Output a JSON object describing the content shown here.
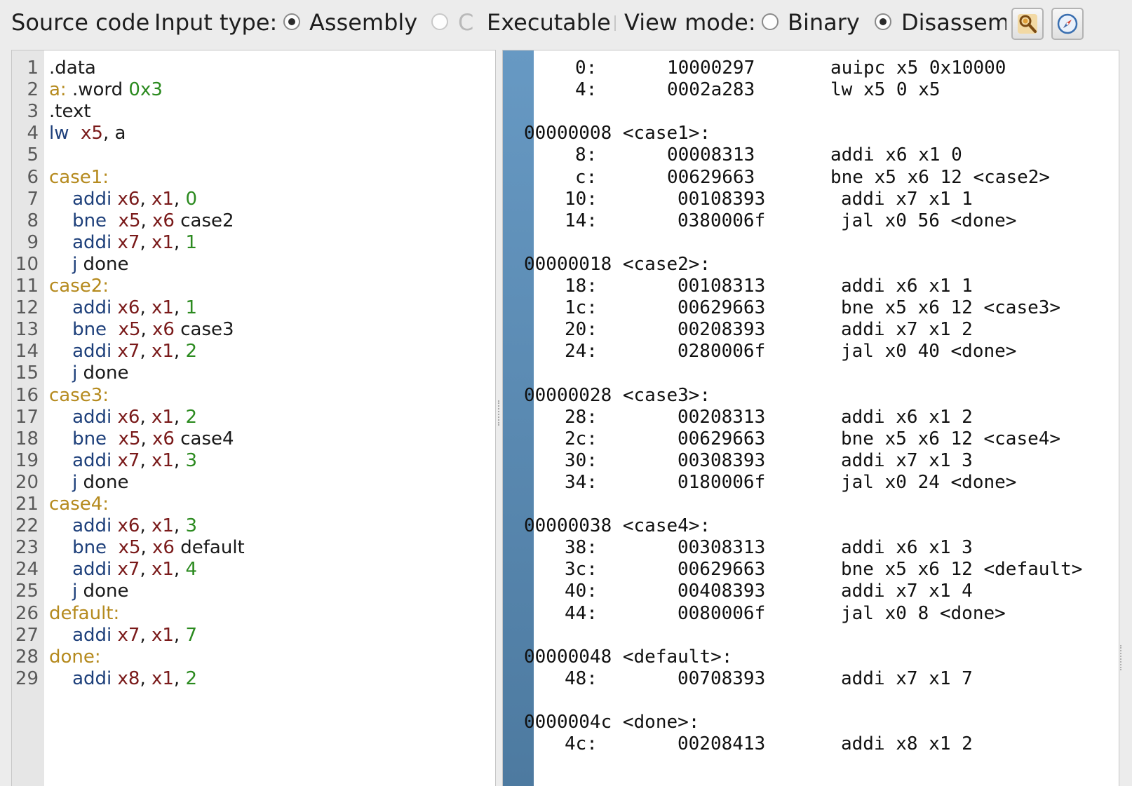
{
  "toolbar": {
    "source_code": "Source code",
    "input_type_label": "Input type:",
    "opt_assembly": "Assembly",
    "opt_c": "C",
    "opt_executable": "Executable",
    "view_mode_label": "View mode:",
    "opt_binary": "Binary",
    "opt_disassembly": "Disassem"
  },
  "source_lines": [
    {
      "n": "1",
      "parts": [
        [
          "",
          ".data"
        ]
      ]
    },
    {
      "n": "2",
      "parts": [
        [
          "lbl",
          "a:"
        ],
        [
          "",
          " .word "
        ],
        [
          "num",
          "0x3"
        ]
      ]
    },
    {
      "n": "3",
      "parts": [
        [
          "",
          ".text"
        ]
      ]
    },
    {
      "n": "4",
      "parts": [
        [
          "op",
          "lw"
        ],
        [
          "",
          "  "
        ],
        [
          "reg",
          "x5"
        ],
        [
          "",
          ", a"
        ]
      ]
    },
    {
      "n": "5",
      "parts": []
    },
    {
      "n": "6",
      "parts": [
        [
          "lbl",
          "case1:"
        ]
      ]
    },
    {
      "n": "7",
      "parts": [
        [
          "",
          "    "
        ],
        [
          "op",
          "addi"
        ],
        [
          "",
          " "
        ],
        [
          "reg",
          "x6"
        ],
        [
          "",
          ", "
        ],
        [
          "reg",
          "x1"
        ],
        [
          "",
          ", "
        ],
        [
          "num",
          "0"
        ]
      ]
    },
    {
      "n": "8",
      "parts": [
        [
          "",
          "    "
        ],
        [
          "op",
          "bne"
        ],
        [
          "",
          "  "
        ],
        [
          "reg",
          "x5"
        ],
        [
          "",
          ", "
        ],
        [
          "reg",
          "x6"
        ],
        [
          "",
          " case2"
        ]
      ]
    },
    {
      "n": "9",
      "parts": [
        [
          "",
          "    "
        ],
        [
          "op",
          "addi"
        ],
        [
          "",
          " "
        ],
        [
          "reg",
          "x7"
        ],
        [
          "",
          ", "
        ],
        [
          "reg",
          "x1"
        ],
        [
          "",
          ", "
        ],
        [
          "num",
          "1"
        ]
      ]
    },
    {
      "n": "10",
      "parts": [
        [
          "",
          "    "
        ],
        [
          "op",
          "j"
        ],
        [
          "",
          " done"
        ]
      ]
    },
    {
      "n": "11",
      "parts": [
        [
          "lbl",
          "case2:"
        ]
      ]
    },
    {
      "n": "12",
      "parts": [
        [
          "",
          "    "
        ],
        [
          "op",
          "addi"
        ],
        [
          "",
          " "
        ],
        [
          "reg",
          "x6"
        ],
        [
          "",
          ", "
        ],
        [
          "reg",
          "x1"
        ],
        [
          "",
          ", "
        ],
        [
          "num",
          "1"
        ]
      ]
    },
    {
      "n": "13",
      "parts": [
        [
          "",
          "    "
        ],
        [
          "op",
          "bne"
        ],
        [
          "",
          "  "
        ],
        [
          "reg",
          "x5"
        ],
        [
          "",
          ", "
        ],
        [
          "reg",
          "x6"
        ],
        [
          "",
          " case3"
        ]
      ]
    },
    {
      "n": "14",
      "parts": [
        [
          "",
          "    "
        ],
        [
          "op",
          "addi"
        ],
        [
          "",
          " "
        ],
        [
          "reg",
          "x7"
        ],
        [
          "",
          ", "
        ],
        [
          "reg",
          "x1"
        ],
        [
          "",
          ", "
        ],
        [
          "num",
          "2"
        ]
      ]
    },
    {
      "n": "15",
      "parts": [
        [
          "",
          "    "
        ],
        [
          "op",
          "j"
        ],
        [
          "",
          " done"
        ]
      ]
    },
    {
      "n": "16",
      "parts": [
        [
          "lbl",
          "case3:"
        ]
      ]
    },
    {
      "n": "17",
      "parts": [
        [
          "",
          "    "
        ],
        [
          "op",
          "addi"
        ],
        [
          "",
          " "
        ],
        [
          "reg",
          "x6"
        ],
        [
          "",
          ", "
        ],
        [
          "reg",
          "x1"
        ],
        [
          "",
          ", "
        ],
        [
          "num",
          "2"
        ]
      ]
    },
    {
      "n": "18",
      "parts": [
        [
          "",
          "    "
        ],
        [
          "op",
          "bne"
        ],
        [
          "",
          "  "
        ],
        [
          "reg",
          "x5"
        ],
        [
          "",
          ", "
        ],
        [
          "reg",
          "x6"
        ],
        [
          "",
          " case4"
        ]
      ]
    },
    {
      "n": "19",
      "parts": [
        [
          "",
          "    "
        ],
        [
          "op",
          "addi"
        ],
        [
          "",
          " "
        ],
        [
          "reg",
          "x7"
        ],
        [
          "",
          ", "
        ],
        [
          "reg",
          "x1"
        ],
        [
          "",
          ", "
        ],
        [
          "num",
          "3"
        ]
      ]
    },
    {
      "n": "20",
      "parts": [
        [
          "",
          "    "
        ],
        [
          "op",
          "j"
        ],
        [
          "",
          " done"
        ]
      ]
    },
    {
      "n": "21",
      "parts": [
        [
          "lbl",
          "case4:"
        ]
      ]
    },
    {
      "n": "22",
      "parts": [
        [
          "",
          "    "
        ],
        [
          "op",
          "addi"
        ],
        [
          "",
          " "
        ],
        [
          "reg",
          "x6"
        ],
        [
          "",
          ", "
        ],
        [
          "reg",
          "x1"
        ],
        [
          "",
          ", "
        ],
        [
          "num",
          "3"
        ]
      ]
    },
    {
      "n": "23",
      "parts": [
        [
          "",
          "    "
        ],
        [
          "op",
          "bne"
        ],
        [
          "",
          "  "
        ],
        [
          "reg",
          "x5"
        ],
        [
          "",
          ", "
        ],
        [
          "reg",
          "x6"
        ],
        [
          "",
          " default"
        ]
      ]
    },
    {
      "n": "24",
      "parts": [
        [
          "",
          "    "
        ],
        [
          "op",
          "addi"
        ],
        [
          "",
          " "
        ],
        [
          "reg",
          "x7"
        ],
        [
          "",
          ", "
        ],
        [
          "reg",
          "x1"
        ],
        [
          "",
          ", "
        ],
        [
          "num",
          "4"
        ]
      ]
    },
    {
      "n": "25",
      "parts": [
        [
          "",
          "    "
        ],
        [
          "op",
          "j"
        ],
        [
          "",
          " done"
        ]
      ]
    },
    {
      "n": "26",
      "parts": [
        [
          "lbl",
          "default:"
        ]
      ]
    },
    {
      "n": "27",
      "parts": [
        [
          "",
          "    "
        ],
        [
          "op",
          "addi"
        ],
        [
          "",
          " "
        ],
        [
          "reg",
          "x7"
        ],
        [
          "",
          ", "
        ],
        [
          "reg",
          "x1"
        ],
        [
          "",
          ", "
        ],
        [
          "num",
          "7"
        ]
      ]
    },
    {
      "n": "28",
      "parts": [
        [
          "lbl",
          "done:"
        ]
      ]
    },
    {
      "n": "29",
      "parts": [
        [
          "",
          "    "
        ],
        [
          "op",
          "addi"
        ],
        [
          "",
          " "
        ],
        [
          "reg",
          "x8"
        ],
        [
          "",
          ", "
        ],
        [
          "reg",
          "x1"
        ],
        [
          "",
          ", "
        ],
        [
          "num",
          "2"
        ]
      ]
    }
  ],
  "disasm_lines": [
    {
      "addr": "0:",
      "hex": "10000297",
      "ins": "auipc x5 0x10000"
    },
    {
      "addr": "4:",
      "hex": "0002a283",
      "ins": "lw x5 0 x5"
    },
    {
      "blank": true
    },
    {
      "header": "00000008 <case1>:"
    },
    {
      "addr": "8:",
      "hex": "00008313",
      "ins": "addi x6 x1 0"
    },
    {
      "addr": "c:",
      "hex": "00629663",
      "ins": "bne x5 x6 12 <case2>"
    },
    {
      "addr": "10:",
      "hex": "00108393",
      "ins": "addi x7 x1 1"
    },
    {
      "addr": "14:",
      "hex": "0380006f",
      "ins": "jal x0 56 <done>"
    },
    {
      "blank": true
    },
    {
      "header": "00000018 <case2>:"
    },
    {
      "addr": "18:",
      "hex": "00108313",
      "ins": "addi x6 x1 1"
    },
    {
      "addr": "1c:",
      "hex": "00629663",
      "ins": "bne x5 x6 12 <case3>"
    },
    {
      "addr": "20:",
      "hex": "00208393",
      "ins": "addi x7 x1 2"
    },
    {
      "addr": "24:",
      "hex": "0280006f",
      "ins": "jal x0 40 <done>"
    },
    {
      "blank": true
    },
    {
      "header": "00000028 <case3>:"
    },
    {
      "addr": "28:",
      "hex": "00208313",
      "ins": "addi x6 x1 2"
    },
    {
      "addr": "2c:",
      "hex": "00629663",
      "ins": "bne x5 x6 12 <case4>"
    },
    {
      "addr": "30:",
      "hex": "00308393",
      "ins": "addi x7 x1 3"
    },
    {
      "addr": "34:",
      "hex": "0180006f",
      "ins": "jal x0 24 <done>"
    },
    {
      "blank": true
    },
    {
      "header": "00000038 <case4>:"
    },
    {
      "addr": "38:",
      "hex": "00308313",
      "ins": "addi x6 x1 3"
    },
    {
      "addr": "3c:",
      "hex": "00629663",
      "ins": "bne x5 x6 12 <default>"
    },
    {
      "addr": "40:",
      "hex": "00408393",
      "ins": "addi x7 x1 4"
    },
    {
      "addr": "44:",
      "hex": "0080006f",
      "ins": "jal x0 8 <done>"
    },
    {
      "blank": true
    },
    {
      "header": "00000048 <default>:"
    },
    {
      "addr": "48:",
      "hex": "00708393",
      "ins": "addi x7 x1 7"
    },
    {
      "blank": true
    },
    {
      "header": "0000004c <done>:"
    },
    {
      "addr": "4c:",
      "hex": "00208413",
      "ins": "addi x8 x1 2"
    }
  ],
  "colors": {
    "opcode": "#1d3f7a",
    "register": "#7a1a1a",
    "number": "#2b8a1f",
    "label": "#b58a1e",
    "disasm_bar": "#5a8ab2"
  },
  "icons": {
    "tool_button_1": "search-person-icon",
    "tool_button_2": "compass-icon"
  }
}
